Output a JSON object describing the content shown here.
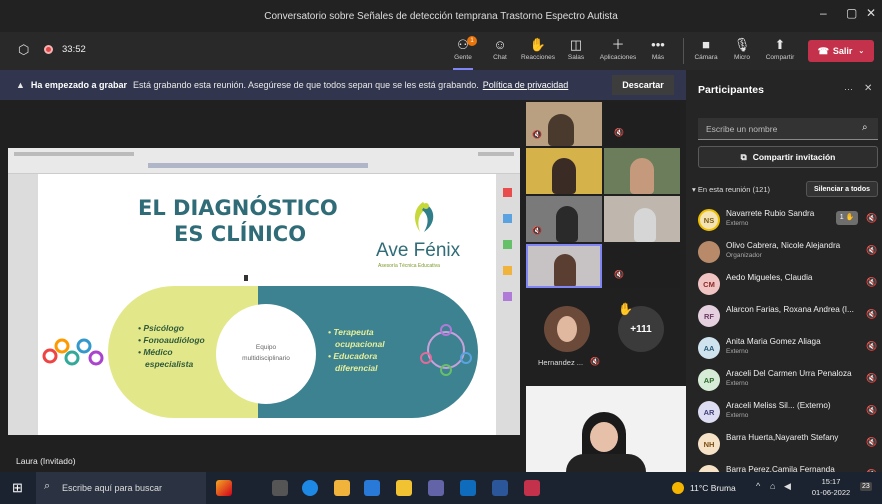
{
  "window": {
    "title": "Conversatorio sobre Señales de detección temprana Trastorno Espectro Autista"
  },
  "toolbar": {
    "timer": "33:52",
    "gente": "Gente",
    "gente_badge": "1",
    "chat": "Chat",
    "reacciones": "Reacciones",
    "salas": "Salas",
    "aplicaciones": "Aplicaciones",
    "mas": "Más",
    "camara": "Cámara",
    "micro": "Micro",
    "compartir": "Compartir",
    "salir": "Salir"
  },
  "banner": {
    "bold": "Ha empezado a grabar",
    "text": "Está grabando esta reunión. Asegúrese de que todos sepan que se les está grabando.",
    "link": "Política de privacidad",
    "button": "Descartar"
  },
  "slide": {
    "title1": "EL DIAGNÓSTICO",
    "title2": "ES CLÍNICO",
    "brand": "Ave Fénix",
    "brand_sub": "Asesoría Técnica Educativa",
    "left_items": [
      "• Psicólogo",
      "• Fonoaudiólogo",
      "• Médico",
      "especialista"
    ],
    "center1": "Equipo",
    "center2": "multidisciplinario",
    "right_items": [
      "• Terapeuta",
      "ocupacional",
      "• Educadora",
      "diferencial"
    ]
  },
  "stage": {
    "presenter_label": "Laura (Invitado)",
    "hernandez": "Hernandez ...",
    "overflow": "+111"
  },
  "panel": {
    "title": "Participantes",
    "search_placeholder": "Escribe un nombre",
    "invite": "Compartir invitación",
    "section": "En esta reunión (121)",
    "silence": "Silenciar a todos",
    "participants": [
      {
        "initials": "NS",
        "name": "Navarrete Rubio Sandra",
        "role": "Externo",
        "color": "#f3e3b5",
        "fg": "#7a5a12"
      },
      {
        "initials": "",
        "name": "Olivo Cabrera, Nicole Alejandra",
        "role": "Organizador",
        "color": "#b98a6a",
        "fg": "#fff"
      },
      {
        "initials": "CM",
        "name": "Aedo Migueles, Claudia",
        "role": "",
        "color": "#f1c4c4",
        "fg": "#8a2a2a"
      },
      {
        "initials": "RF",
        "name": "Alarcon Farias, Roxana Andrea (I...",
        "role": "",
        "color": "#e5d0e0",
        "fg": "#6c3a5f"
      },
      {
        "initials": "AA",
        "name": "Anita Maria Gomez Aliaga",
        "role": "Externo",
        "color": "#cfe3ee",
        "fg": "#2a5a78"
      },
      {
        "initials": "AP",
        "name": "Araceli Del Carmen Urra Penaloza",
        "role": "Externo",
        "color": "#d7ecd7",
        "fg": "#2e6a2e"
      },
      {
        "initials": "AR",
        "name": "Araceli Meliss Sil... (Externo)",
        "role": "Externo",
        "color": "#dcdcf2",
        "fg": "#40407a"
      },
      {
        "initials": "NH",
        "name": "Barra Huerta,Nayareth Stefany",
        "role": "",
        "color": "#f6e2c7",
        "fg": "#7a4e12"
      },
      {
        "initials": "CP",
        "name": "Barra Perez,Camila Fernanda",
        "role": "",
        "color": "#f6e2c7",
        "fg": "#7a4e12"
      }
    ]
  },
  "taskbar": {
    "search": "Escribe aquí para buscar",
    "weather": "11°C Bruma",
    "time": "15:17",
    "date": "01-06-2022",
    "badge": "23"
  }
}
